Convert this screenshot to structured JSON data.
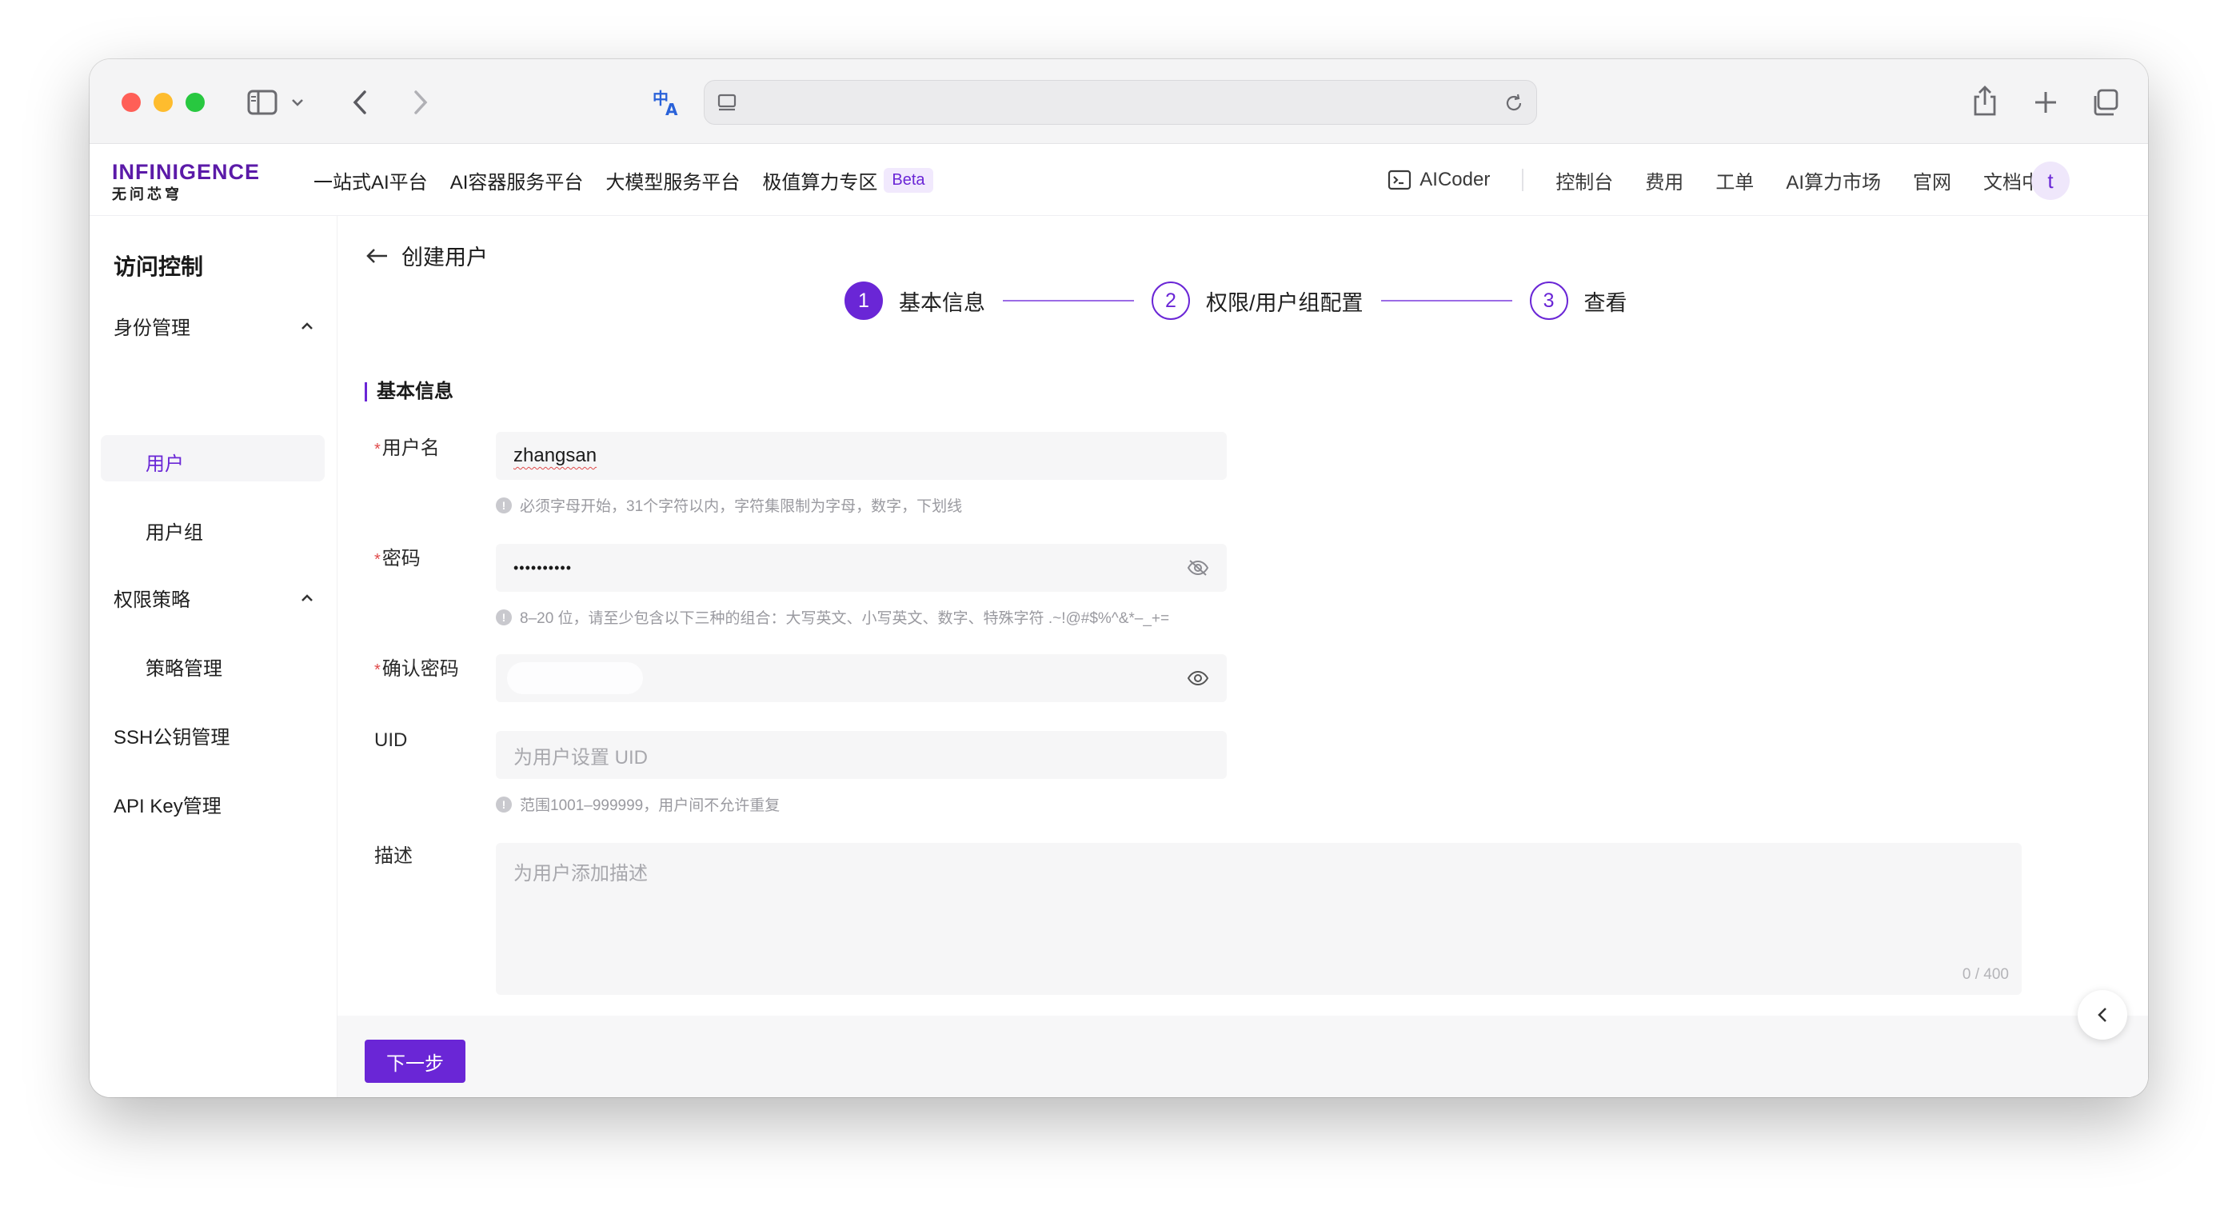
{
  "nav": {
    "logo_main": "INFINIGENCE",
    "logo_sub": "无问芯穹",
    "left_items": [
      "一站式AI平台",
      "AI容器服务平台",
      "大模型服务平台",
      "极值算力专区"
    ],
    "beta_badge": "Beta",
    "aicoder": "AICoder",
    "right_items": [
      "控制台",
      "费用",
      "工单",
      "AI算力市场",
      "官网",
      "文档中心"
    ],
    "avatar_letter": "t"
  },
  "sidebar": {
    "title": "访问控制",
    "groups": [
      {
        "label": "身份管理",
        "items": [
          "用户",
          "用户组"
        ]
      },
      {
        "label": "权限策略",
        "items": [
          "策略管理"
        ]
      }
    ],
    "extra_items": [
      "SSH公钥管理",
      "API Key管理"
    ],
    "active_item": "用户"
  },
  "page": {
    "title": "创建用户",
    "steps": [
      {
        "num": "1",
        "label": "基本信息"
      },
      {
        "num": "2",
        "label": "权限/用户组配置"
      },
      {
        "num": "3",
        "label": "查看"
      }
    ],
    "section_title": "基本信息"
  },
  "form": {
    "username": {
      "label": "用户名",
      "value": "zhangsan",
      "hint": "必须字母开始，31个字符以内，字符集限制为字母，数字，下划线"
    },
    "password": {
      "label": "密码",
      "value": "••••••••••",
      "hint": "8–20 位，请至少包含以下三种的组合：大写英文、小写英文、数字、特殊字符 .~!@#$%^&*–_+="
    },
    "confirm_password": {
      "label": "确认密码",
      "value": ""
    },
    "uid": {
      "label": "UID",
      "placeholder": "为用户设置 UID",
      "hint": "范围1001–999999，用户间不允许重复"
    },
    "description": {
      "label": "描述",
      "placeholder": "为用户添加描述",
      "counter": "0 / 400"
    },
    "next_button": "下一步"
  }
}
